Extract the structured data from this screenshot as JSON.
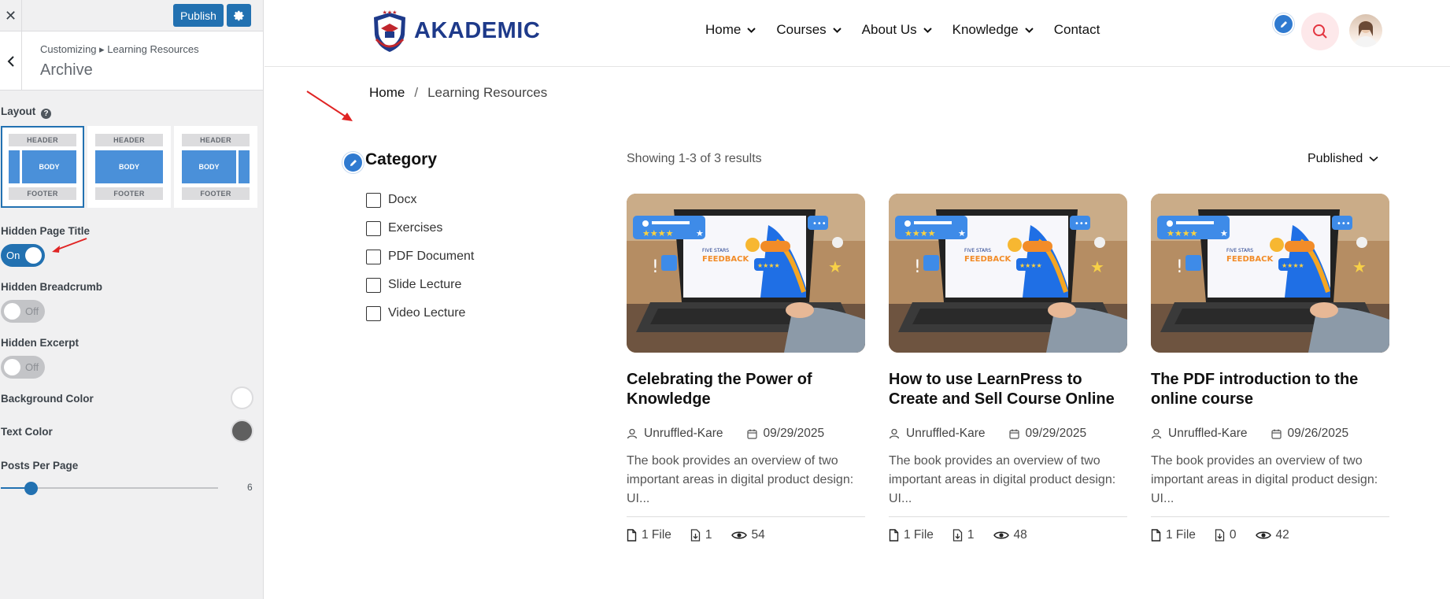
{
  "customizer": {
    "publish_label": "Publish",
    "breadcrumb": "Customizing ▸ Learning Resources",
    "section_title": "Archive",
    "layout_label": "Layout",
    "layout_options": [
      {
        "header": "HEADER",
        "body": "BODY",
        "footer": "FOOTER",
        "variant": "left-sidebar",
        "selected": true
      },
      {
        "header": "HEADER",
        "body": "BODY",
        "footer": "FOOTER",
        "variant": "full-width",
        "selected": false
      },
      {
        "header": "HEADER",
        "body": "BODY",
        "footer": "FOOTER",
        "variant": "right-sidebar",
        "selected": false
      }
    ],
    "hidden_page_title": {
      "label": "Hidden Page Title",
      "state": "On"
    },
    "hidden_breadcrumb": {
      "label": "Hidden Breadcrumb",
      "state": "Off"
    },
    "hidden_excerpt": {
      "label": "Hidden Excerpt",
      "state": "Off"
    },
    "background_color": {
      "label": "Background Color",
      "value": "#ffffff"
    },
    "text_color": {
      "label": "Text Color",
      "value": "#5f5f5f"
    },
    "posts_per_page": {
      "label": "Posts Per Page",
      "value": "6",
      "fraction": 0.14
    }
  },
  "site": {
    "logo_text": "AKADEMIC",
    "nav": [
      "Home",
      "Courses",
      "About Us",
      "Knowledge",
      "Contact"
    ],
    "nav_has_dropdown": [
      true,
      true,
      true,
      true,
      false
    ],
    "breadcrumb": {
      "home": "Home",
      "sep": "/",
      "current": "Learning Resources"
    },
    "category": {
      "title": "Category",
      "items": [
        "Docx",
        "Exercises",
        "PDF Document",
        "Slide Lecture",
        "Video Lecture"
      ]
    },
    "results_text": "Showing 1-3 of 3 results",
    "sort_label": "Published",
    "posts": [
      {
        "title": "Celebrating the Power of Knowledge",
        "author": "Unruffled-Kare",
        "date": "09/29/2025",
        "excerpt": "The book provides an overview of two important areas in digital product design: UI...",
        "files": "1 File",
        "downloads": "1",
        "views": "54"
      },
      {
        "title": "How to use LearnPress to Create and Sell Course Online",
        "author": "Unruffled-Kare",
        "date": "09/29/2025",
        "excerpt": "The book provides an overview of two important areas in digital product design: UI...",
        "files": "1 File",
        "downloads": "1",
        "views": "48"
      },
      {
        "title": "The PDF introduction to the online course",
        "author": "Unruffled-Kare",
        "date": "09/26/2025",
        "excerpt": "The book provides an overview of two important areas in digital product design: UI...",
        "files": "1 File",
        "downloads": "0",
        "views": "42"
      }
    ],
    "thumbnail_text": {
      "badge": "FIVE STARS",
      "headline": "FEEDBACK"
    }
  },
  "colors": {
    "accent": "#2271b1",
    "brand": "#1e3a8a",
    "search_bg": "#fde8ea",
    "annotation_arrow": "#e02424"
  }
}
